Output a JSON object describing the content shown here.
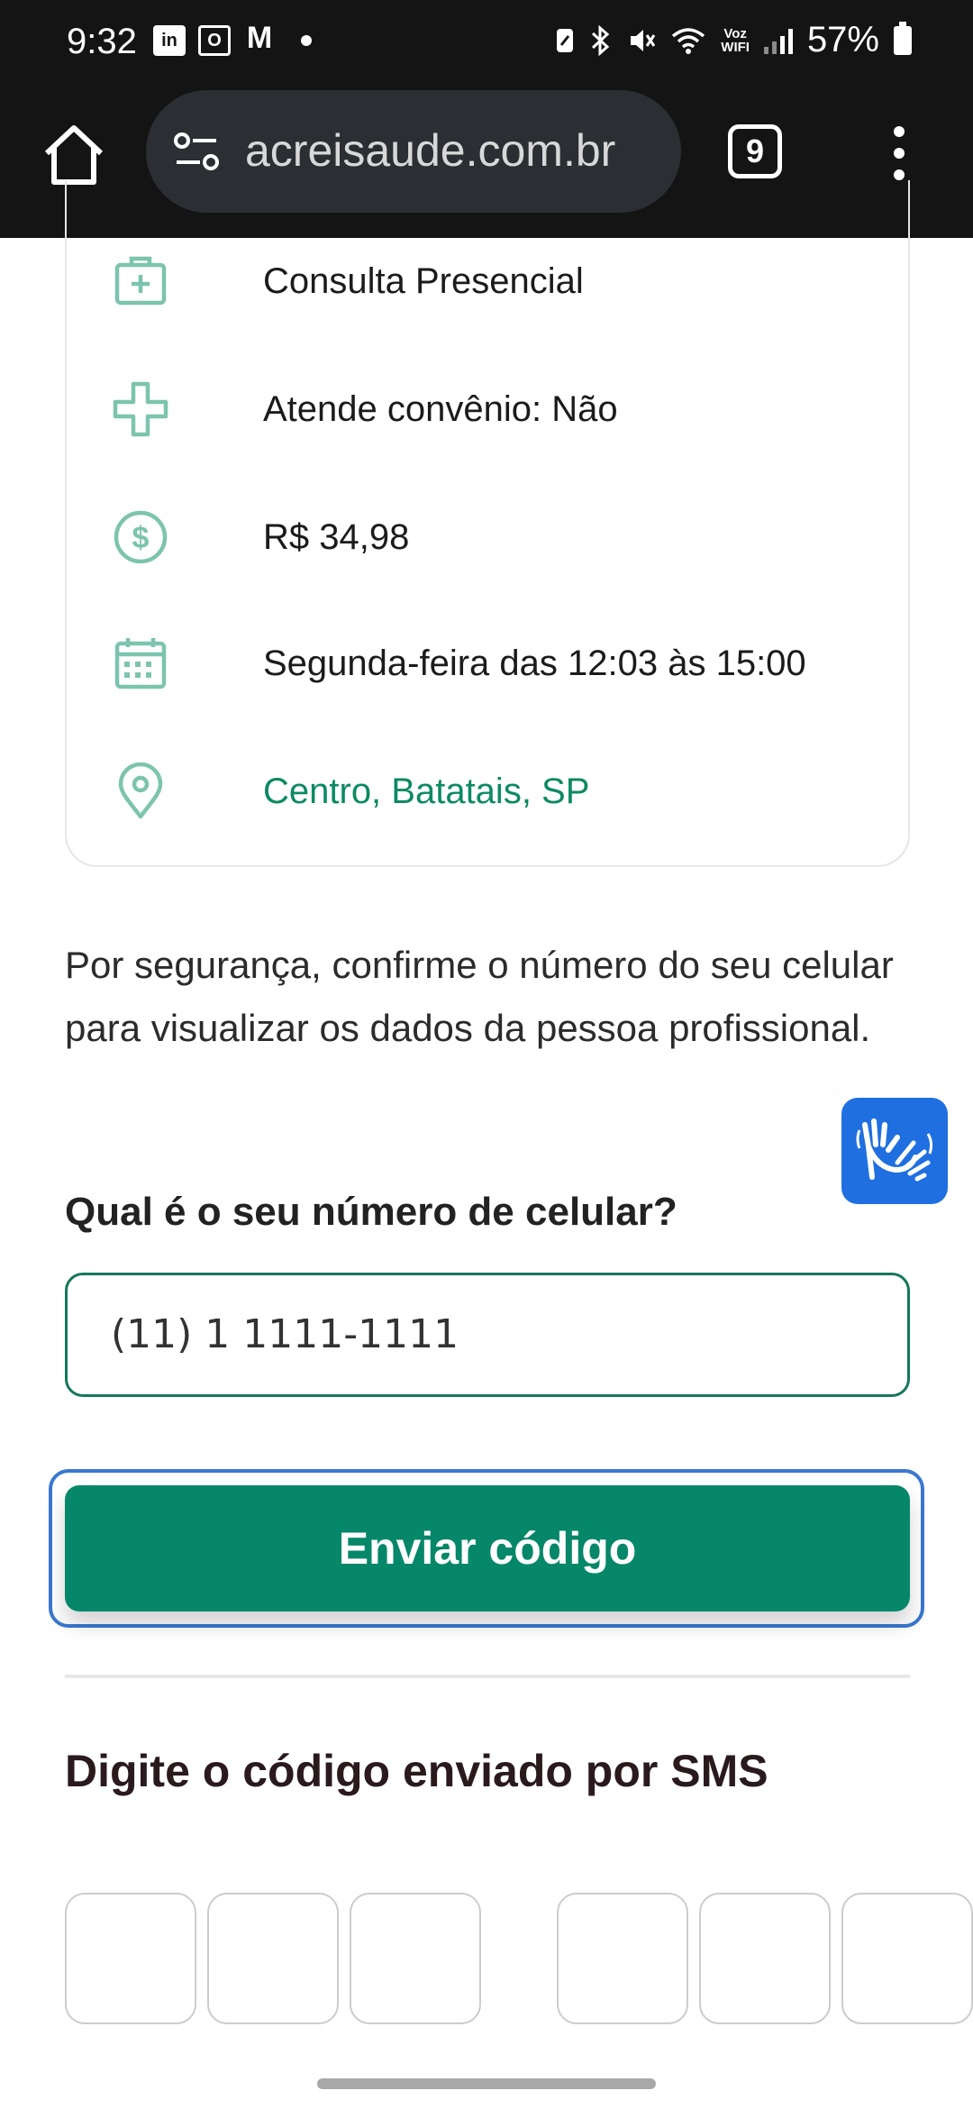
{
  "status_bar": {
    "time": "9:32",
    "battery": "57%",
    "left_icons": [
      "linkedin-icon",
      "outlook-icon",
      "gmail-icon"
    ],
    "right_icons": [
      "nfc-icon",
      "bluetooth-icon",
      "mute-icon",
      "wifi-icon",
      "vowifi-icon",
      "signal-icon",
      "battery-icon"
    ]
  },
  "browser": {
    "url": "acreisaude.com.br",
    "tab_count": "9"
  },
  "card": {
    "items": [
      {
        "icon": "medical-kit-icon",
        "label": "Consulta Presencial"
      },
      {
        "icon": "plus-cross-icon",
        "label": "Atende convênio: Não"
      },
      {
        "icon": "dollar-icon",
        "label": "R$ 34,98"
      },
      {
        "icon": "calendar-icon",
        "label": "Segunda-feira das 12:03 às 15:00"
      },
      {
        "icon": "location-pin-icon",
        "label": "Centro, Batatais, SP"
      }
    ]
  },
  "form": {
    "security_text": "Por segurança, confirme o número do seu celular para visualizar os dados da pessoa profissional.",
    "question": "Qual é o seu número de celular?",
    "phone_value": "(11) 1 1111-1111",
    "send_button": "Enviar código",
    "sms_title": "Digite o código enviado por SMS"
  },
  "colors": {
    "accent_green": "#06876a",
    "icon_green": "#7cc4ad",
    "libras_blue": "#1f6fe0"
  }
}
